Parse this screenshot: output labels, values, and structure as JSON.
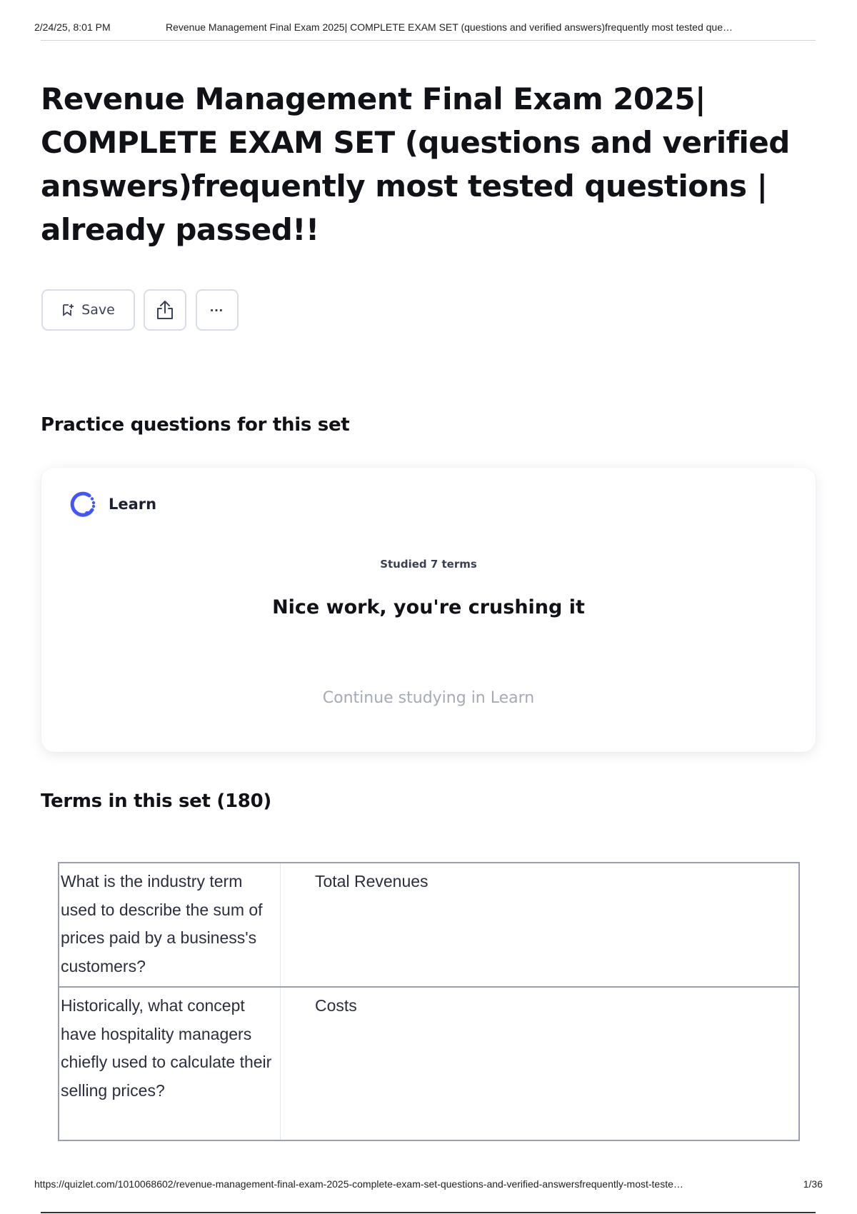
{
  "print_header": {
    "date": "2/24/25, 8:01 PM",
    "doc_title": "Revenue Management Final Exam 2025| COMPLETE EXAM SET (questions and verified answers)frequently most tested que…"
  },
  "set": {
    "title": "Revenue Management Final Exam 2025| COMPLETE EXAM SET (questions and verified answers)frequently most tested questions | already passed!!"
  },
  "actions": {
    "save_label": "Save",
    "save_icon": "bookmark-plus-icon",
    "share_icon": "share-icon",
    "more_icon": "more-icon"
  },
  "practice": {
    "heading": "Practice questions for this set",
    "learn_label": "Learn",
    "studied_text": "Studied 7 terms",
    "message": "Nice work, you're crushing it",
    "continue_label": "Continue studying in Learn"
  },
  "terms": {
    "heading": "Terms in this set (180)",
    "rows": [
      {
        "question": "What is the industry term used to describe the sum of prices paid by a business's customers?",
        "answer": "Total Revenues"
      },
      {
        "question": "Historically, what concept have hospitality managers chiefly used to calculate their selling prices?",
        "answer": "Costs"
      }
    ]
  },
  "print_footer": {
    "url": "https://quizlet.com/1010068602/revenue-management-final-exam-2025-complete-exam-set-questions-and-verified-answersfrequently-most-teste…",
    "page": "1/36"
  },
  "colors": {
    "learn_accent": "#4255ff",
    "muted_text": "#a5aab8",
    "border": "#d9dde8"
  }
}
